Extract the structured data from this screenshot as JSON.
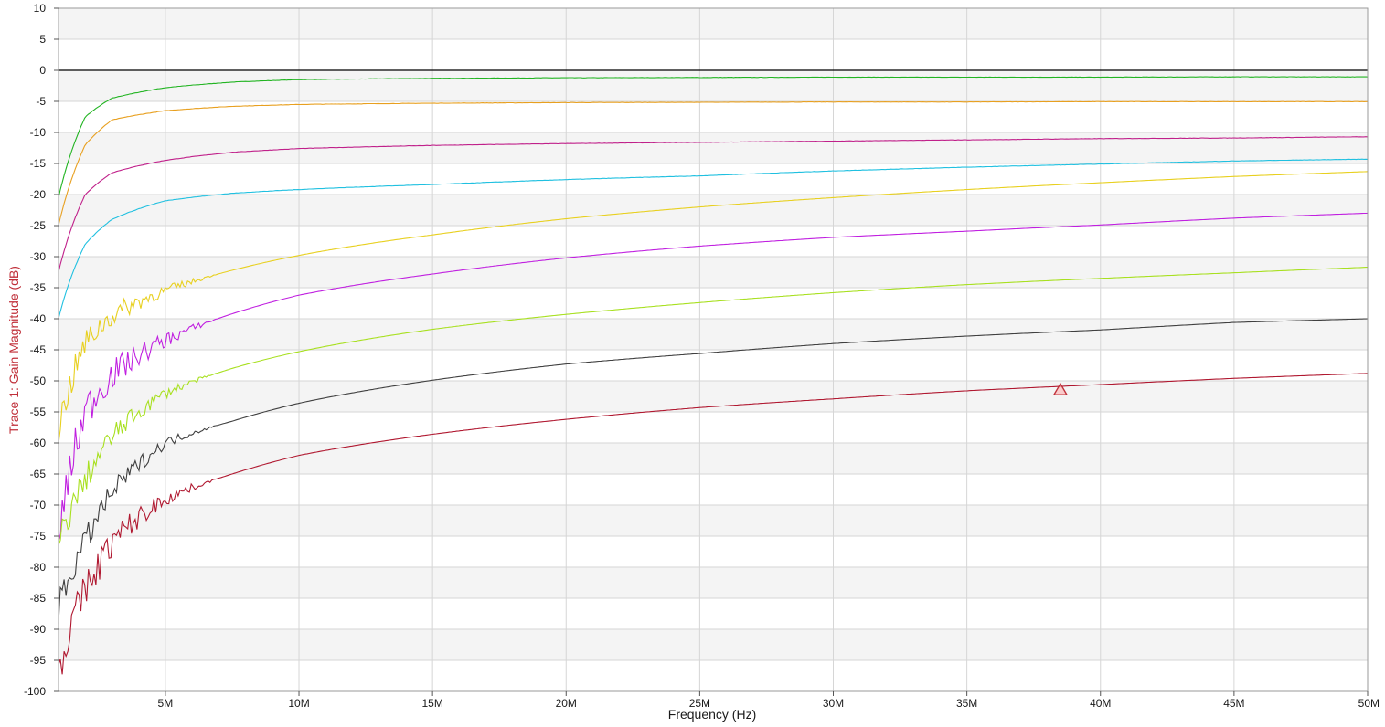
{
  "chart_data": {
    "type": "line",
    "xlabel": "Frequency (Hz)",
    "ylabel": "Trace 1: Gain Magnitude (dB)",
    "xlim": [
      1000000,
      50000000
    ],
    "ylim": [
      -100,
      10
    ],
    "x_ticks": [
      5000000,
      10000000,
      15000000,
      20000000,
      25000000,
      30000000,
      35000000,
      40000000,
      45000000,
      50000000
    ],
    "x_tick_labels": [
      "5M",
      "10M",
      "15M",
      "20M",
      "25M",
      "30M",
      "35M",
      "40M",
      "45M",
      "50M"
    ],
    "y_ticks": [
      10,
      5,
      0,
      -5,
      -10,
      -15,
      -20,
      -25,
      -30,
      -35,
      -40,
      -45,
      -50,
      -55,
      -60,
      -65,
      -70,
      -75,
      -80,
      -85,
      -90,
      -95,
      -100
    ],
    "y_tick_labels": [
      "10",
      "5",
      "0",
      "-5",
      "-10",
      "-15",
      "-20",
      "-25",
      "-30",
      "-35",
      "-40",
      "-45",
      "-50",
      "-55",
      "-60",
      "-65",
      "-70",
      "-75",
      "-80",
      "-85",
      "-90",
      "-95",
      "-100"
    ],
    "grid": true,
    "reference_line_y": 0,
    "colors": {
      "ylabel": "#c0303a",
      "band": "#f4f4f4",
      "grid": "#d6d6d6",
      "reference_line": "#000000"
    },
    "x": [
      1000000,
      2000000,
      3000000,
      5000000,
      7500000,
      10000000,
      15000000,
      20000000,
      25000000,
      30000000,
      35000000,
      40000000,
      45000000,
      50000000
    ],
    "series": [
      {
        "color": "#22b422",
        "values": [
          -20.5,
          -7.5,
          -4.5,
          -2.8,
          -1.9,
          -1.5,
          -1.3,
          -1.2,
          -1.15,
          -1.1,
          -1.1,
          -1.1,
          -1.05,
          -1.05
        ]
      },
      {
        "color": "#e8a020",
        "values": [
          -25,
          -12,
          -8,
          -6.5,
          -5.8,
          -5.5,
          -5.3,
          -5.2,
          -5.15,
          -5.1,
          -5.1,
          -5.05,
          -5.05,
          -5.05
        ]
      },
      {
        "color": "#c0208a",
        "values": [
          -32.5,
          -20,
          -16.5,
          -14.5,
          -13.2,
          -12.6,
          -12.1,
          -11.8,
          -11.6,
          -11.4,
          -11.2,
          -11.0,
          -10.9,
          -10.7
        ]
      },
      {
        "color": "#20c0e0",
        "values": [
          -40,
          -28,
          -24,
          -21,
          -19.8,
          -19.2,
          -18.4,
          -17.6,
          -17.0,
          -16.2,
          -15.6,
          -15.1,
          -14.6,
          -14.3
        ]
      },
      {
        "color": "#e8d020",
        "values": [
          -58,
          -44,
          -39.5,
          -35.5,
          -32.2,
          -29.8,
          -26.5,
          -23.9,
          -22.0,
          -20.5,
          -19.2,
          -18.1,
          -17.1,
          -16.3
        ]
      },
      {
        "color": "#c020e0",
        "values": [
          -75,
          -55,
          -49,
          -43.5,
          -39.2,
          -36.2,
          -32.8,
          -30.2,
          -28.3,
          -26.9,
          -25.9,
          -24.9,
          -23.8,
          -23.0
        ]
      },
      {
        "color": "#a8e020",
        "values": [
          -76.5,
          -66,
          -59,
          -52,
          -48.0,
          -45.3,
          -41.7,
          -39.3,
          -37.4,
          -35.8,
          -34.5,
          -33.5,
          -32.6,
          -31.7
        ]
      },
      {
        "color": "#404040",
        "values": [
          -87,
          -76,
          -68,
          -60,
          -56.5,
          -53.6,
          -49.9,
          -47.3,
          -45.6,
          -44.0,
          -42.8,
          -41.8,
          -40.6,
          -40.0
        ]
      },
      {
        "color": "#b01830",
        "values": [
          -96.5,
          -84,
          -76,
          -69,
          -65.0,
          -62.0,
          -58.6,
          -56.2,
          -54.3,
          -52.9,
          -51.6,
          -50.6,
          -49.6,
          -48.8
        ]
      }
    ],
    "marker": {
      "x": 38500000,
      "y": -51.5,
      "shape": "triangle",
      "color": "#c0303a"
    }
  }
}
